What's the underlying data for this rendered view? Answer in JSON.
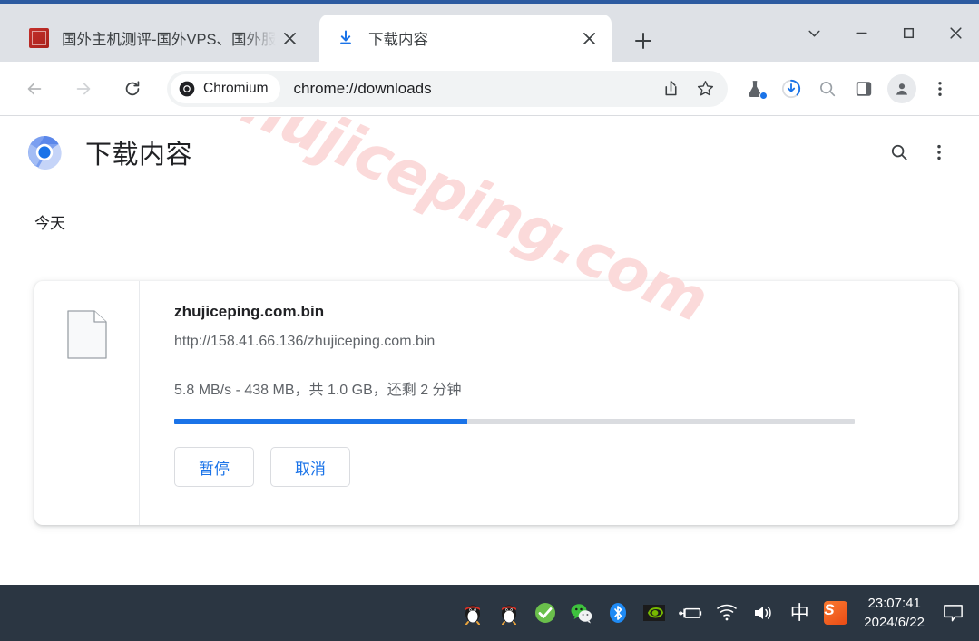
{
  "window": {
    "caption_buttons": [
      {
        "name": "tab-search",
        "glyph": "chevron-down"
      },
      {
        "name": "minimize",
        "glyph": "minus"
      },
      {
        "name": "maximize",
        "glyph": "square"
      },
      {
        "name": "close",
        "glyph": "x"
      }
    ]
  },
  "tabs": [
    {
      "title": "国外主机测评-国外VPS、国外服务器",
      "favicon": "site-favicon",
      "active": false
    },
    {
      "title": "下载内容",
      "favicon": "download-icon",
      "active": true
    }
  ],
  "newtab_label": "+",
  "toolbar": {
    "back_icon": "back-arrow-icon",
    "forward_icon": "forward-arrow-icon",
    "reload_icon": "reload-icon",
    "chip_label": "Chromium",
    "chip_icon": "chromium-icon",
    "url": "chrome://downloads",
    "share_icon": "share-icon",
    "bookmark_icon": "star-icon",
    "experiments_icon": "flask-icon",
    "downloads_icon": "download-progress-icon",
    "search_icon": "search-icon",
    "sidepanel_icon": "side-panel-icon",
    "profile_icon": "avatar-icon",
    "menu_icon": "three-dot-menu-icon"
  },
  "page": {
    "logo": "chromium-logo",
    "title": "下载内容",
    "search_icon": "search-icon",
    "menu_icon": "three-dot-menu-icon",
    "section_date": "今天",
    "watermark": "zhujiceping.com"
  },
  "download": {
    "file_icon": "generic-file-icon",
    "filename": "zhujiceping.com.bin",
    "url": "http://158.41.66.136/zhujiceping.com.bin",
    "status": "5.8 MB/s - 438 MB，共 1.0 GB，还剩 2 分钟",
    "speed": "5.8 MB/s",
    "downloaded": "438 MB",
    "total": "1.0 GB",
    "time_remaining": "2 分钟",
    "progress_percent": 43,
    "progress_color": "#1a73e8",
    "pause_label": "暂停",
    "cancel_label": "取消"
  },
  "taskbar": {
    "tray_icons": [
      "qq-icon",
      "qq-icon-2",
      "360-security-icon",
      "wechat-icon",
      "bluetooth-icon",
      "nvidia-icon",
      "battery-charging-icon",
      "wifi-icon",
      "volume-icon"
    ],
    "ime_label": "中",
    "sogou_label": "S",
    "time": "23:07:41",
    "date": "2024/6/22",
    "notification_icon": "notification-icon"
  },
  "colors": {
    "accent": "#1a73e8",
    "tabstrip_bg": "#dee1e6",
    "taskbar_bg": "#2b3642",
    "window_border": "#2c5aa0",
    "watermark": "#fbdada"
  }
}
